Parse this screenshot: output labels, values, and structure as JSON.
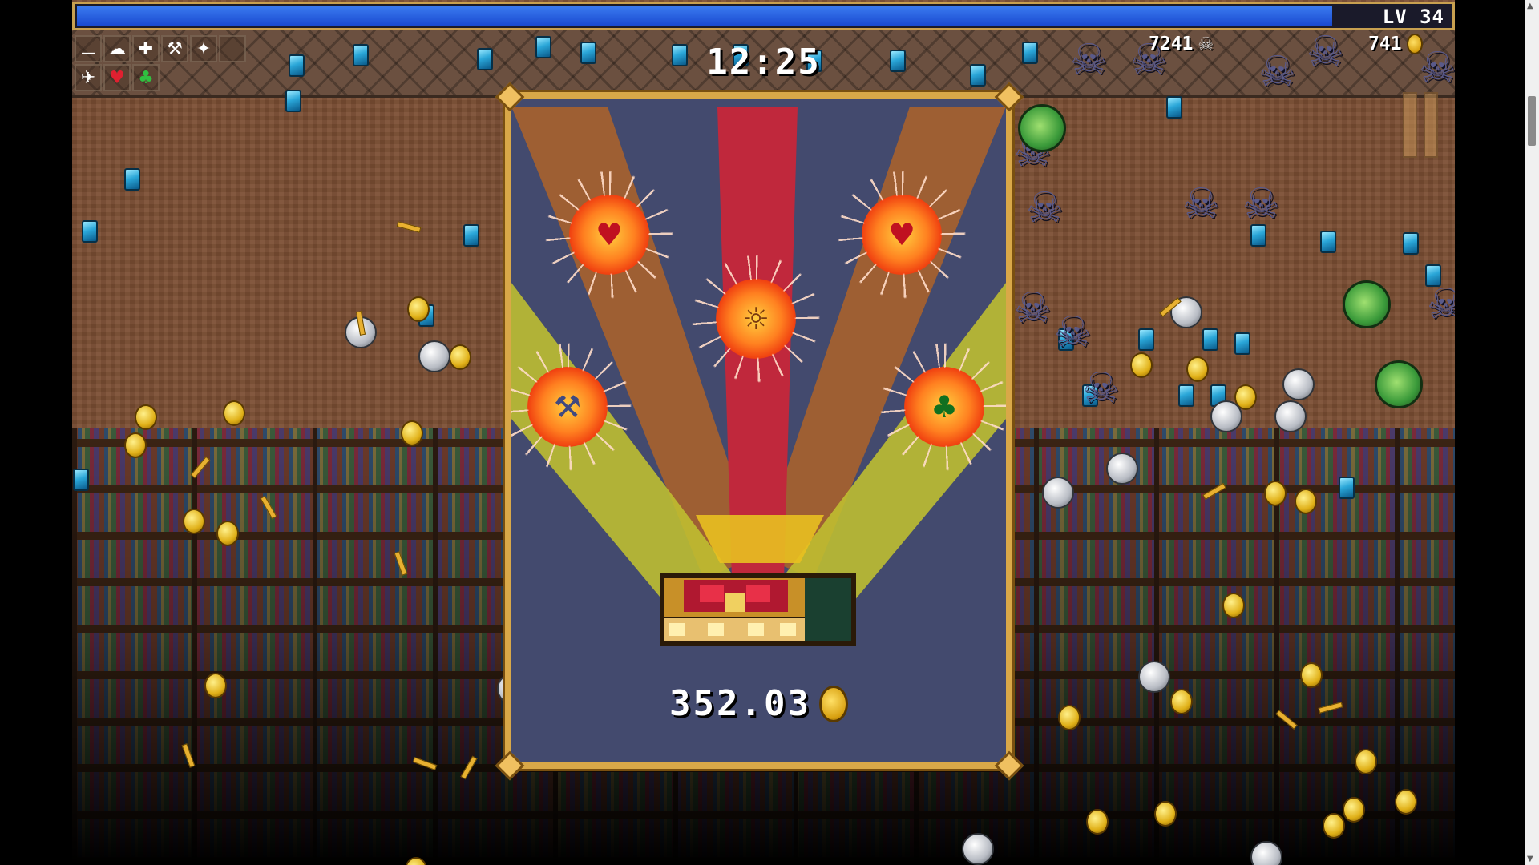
{
  "hud": {
    "level_label": "LV 34",
    "xp_fraction": 0.914,
    "timer": "12:25",
    "kill_count": "7241",
    "gold_count": "741"
  },
  "inventory": {
    "weapons": [
      "whip-icon",
      "garlic-icon",
      "cross-icon",
      "axe-icon",
      "magic-wand-icon",
      "empty-slot"
    ],
    "passives": [
      "wings-icon",
      "heart-icon",
      "clover-icon"
    ]
  },
  "chest": {
    "reward_amount": "352.03",
    "rewards": [
      "heart-icon",
      "heart-icon",
      "candelabrador-icon",
      "axe-icon",
      "clover-icon"
    ]
  },
  "colors": {
    "xp_bar": "#2a5ae0",
    "panel_frame": "#d9a848",
    "panel_bg": "#434a6e",
    "ray_red": "#c0283c",
    "ray_orange": "#a8622c",
    "ray_yellow": "#c0c030"
  }
}
